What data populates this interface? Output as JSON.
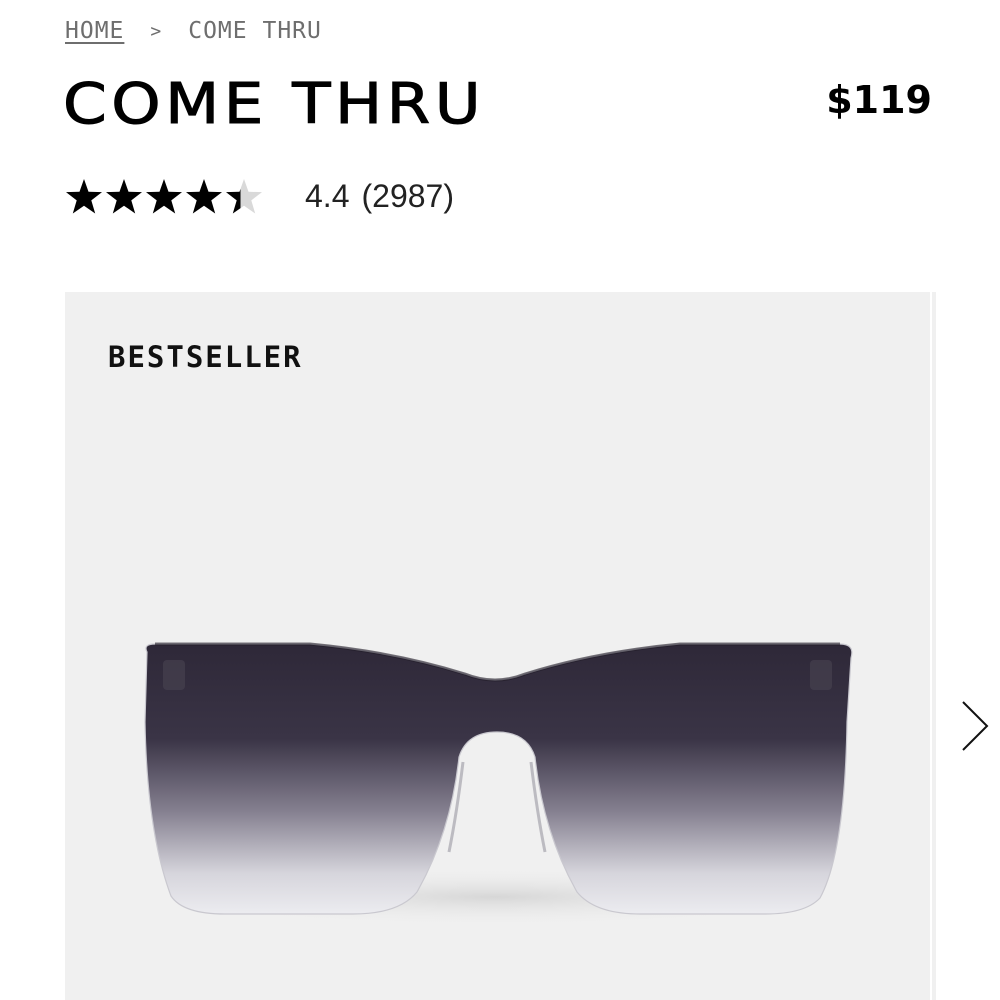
{
  "breadcrumb": {
    "home": "HOME",
    "separator": ">",
    "current": "COME THRU"
  },
  "product": {
    "title": "COME THRU",
    "price": "$119",
    "rating": {
      "value": "4.4",
      "count": "(2987)",
      "stars_filled": 4.4,
      "stars_total": 5
    },
    "badge": "BESTSELLER"
  },
  "icons": {
    "star": "star-icon",
    "next": "chevron-right-icon"
  },
  "colors": {
    "gallery_bg": "#f0f0f0",
    "lens_top": "#2e2838",
    "lens_bottom": "#e8e8ec"
  }
}
